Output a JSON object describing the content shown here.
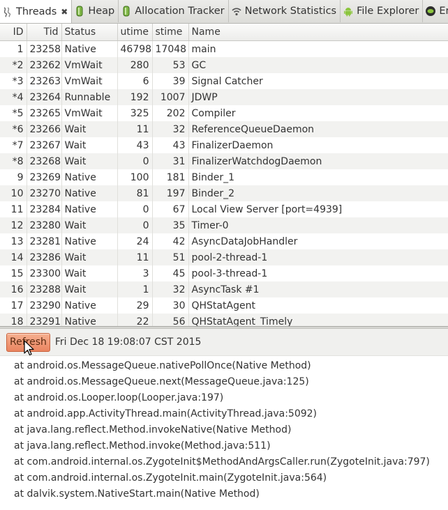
{
  "tabs": [
    {
      "label": "Threads",
      "icon": "threads-icon",
      "active": true,
      "closable": true
    },
    {
      "label": "Heap",
      "icon": "heap-icon",
      "active": false
    },
    {
      "label": "Allocation Tracker",
      "icon": "allocation-tracker-icon",
      "active": false
    },
    {
      "label": "Network Statistics",
      "icon": "network-wifi-icon",
      "active": false
    },
    {
      "label": "File Explorer",
      "icon": "android-icon",
      "active": false
    },
    {
      "label": "Emul",
      "icon": "emulator-icon",
      "active": false
    }
  ],
  "threads_table": {
    "columns": [
      "ID",
      "Tid",
      "Status",
      "utime",
      "stime",
      "Name"
    ],
    "rows": [
      [
        "1",
        "23258",
        "Native",
        "46798",
        "17048",
        "main"
      ],
      [
        "*2",
        "23262",
        "VmWait",
        "280",
        "53",
        "GC"
      ],
      [
        "*3",
        "23263",
        "VmWait",
        "6",
        "39",
        "Signal Catcher"
      ],
      [
        "*4",
        "23264",
        "Runnable",
        "192",
        "1007",
        "JDWP"
      ],
      [
        "*5",
        "23265",
        "VmWait",
        "325",
        "202",
        "Compiler"
      ],
      [
        "*6",
        "23266",
        "Wait",
        "11",
        "32",
        "ReferenceQueueDaemon"
      ],
      [
        "*7",
        "23267",
        "Wait",
        "43",
        "43",
        "FinalizerDaemon"
      ],
      [
        "*8",
        "23268",
        "Wait",
        "0",
        "31",
        "FinalizerWatchdogDaemon"
      ],
      [
        "9",
        "23269",
        "Native",
        "100",
        "181",
        "Binder_1"
      ],
      [
        "10",
        "23270",
        "Native",
        "81",
        "197",
        "Binder_2"
      ],
      [
        "11",
        "23284",
        "Native",
        "0",
        "67",
        "Local View Server [port=4939]"
      ],
      [
        "12",
        "23280",
        "Wait",
        "0",
        "35",
        "Timer-0"
      ],
      [
        "13",
        "23281",
        "Native",
        "24",
        "42",
        "AsyncDataJobHandler"
      ],
      [
        "14",
        "23286",
        "Wait",
        "11",
        "51",
        "pool-2-thread-1"
      ],
      [
        "15",
        "23300",
        "Wait",
        "3",
        "45",
        "pool-3-thread-1"
      ],
      [
        "16",
        "23288",
        "Wait",
        "1",
        "32",
        "AsyncTask #1"
      ],
      [
        "17",
        "23290",
        "Native",
        "29",
        "30",
        "QHStatAgent"
      ],
      [
        "18",
        "23291",
        "Native",
        "22",
        "56",
        "QHStatAgent_Timely"
      ]
    ]
  },
  "toolbar": {
    "refresh_label": "Refresh",
    "timestamp": "Fri Dec 18 19:08:07 CST 2015"
  },
  "stack_trace": [
    "at android.os.MessageQueue.nativePollOnce(Native Method)",
    "at android.os.MessageQueue.next(MessageQueue.java:125)",
    "at android.os.Looper.loop(Looper.java:197)",
    "at android.app.ActivityThread.main(ActivityThread.java:5092)",
    "at java.lang.reflect.Method.invokeNative(Native Method)",
    "at java.lang.reflect.Method.invoke(Method.java:511)",
    "at com.android.internal.os.ZygoteInit$MethodAndArgsCaller.run(ZygoteInit.java:797)",
    "at com.android.internal.os.ZygoteInit.main(ZygoteInit.java:564)",
    "at dalvik.system.NativeStart.main(Native Method)"
  ],
  "colors": {
    "refresh_button": "#ee8c66",
    "row_stripe": "#f2f2f0",
    "tab_bar": "#e4e4e0"
  }
}
